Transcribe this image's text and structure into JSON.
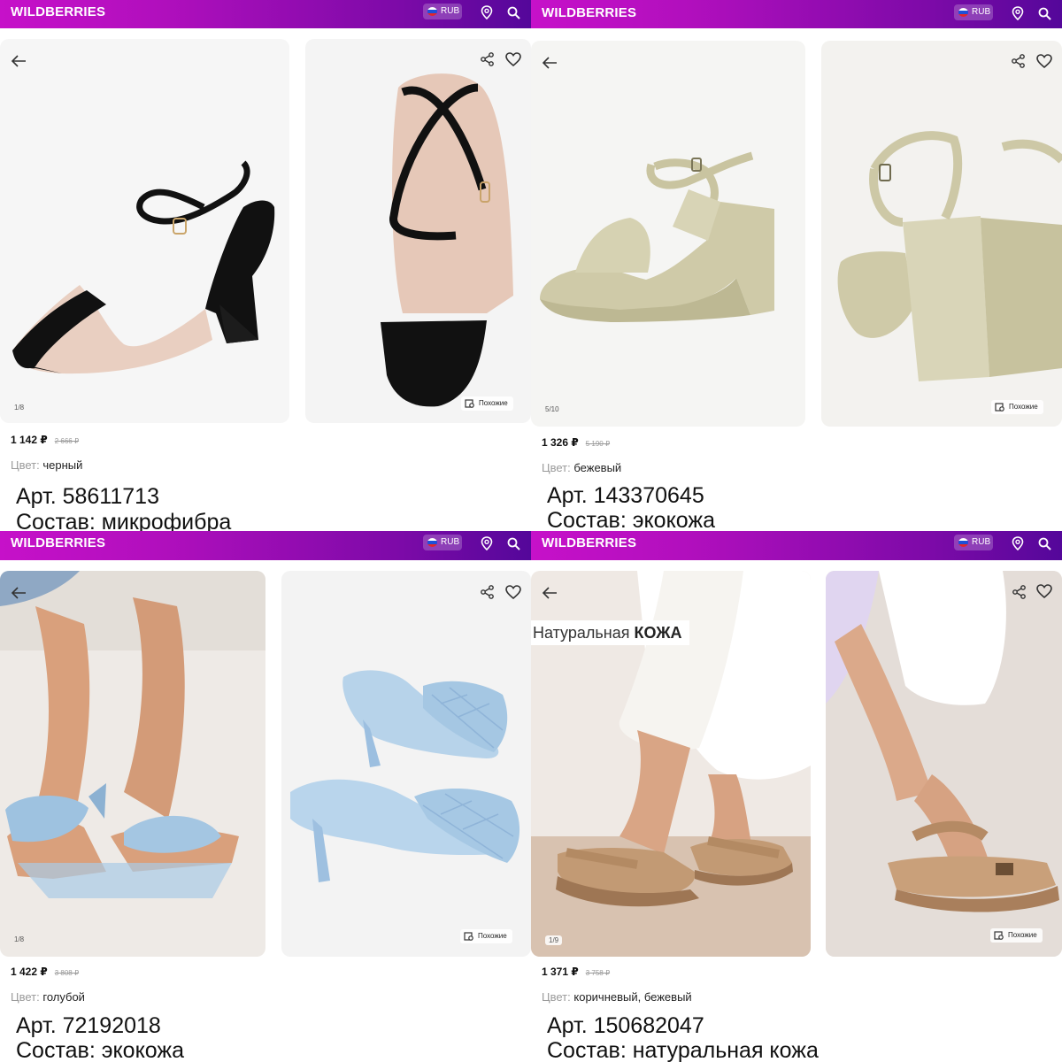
{
  "brand": "WILDBERRIES",
  "currency": "RUB",
  "similar_label": "Похожие",
  "color_label": "Цвет:",
  "products": [
    {
      "counter": "1/8",
      "price": "1 142 ₽",
      "old_price": "2 666 ₽",
      "color": "черный",
      "article": "Арт. 58611713",
      "composition": "Состав: микрофибра"
    },
    {
      "counter": "5/10",
      "price": "1 326 ₽",
      "old_price": "5 190 ₽",
      "color": "бежевый",
      "article": "Арт. 143370645",
      "composition": "Состав: экокожа"
    },
    {
      "counter": "1/8",
      "price": "1 422 ₽",
      "old_price": "3 808 ₽",
      "color": "голубой",
      "article": "Арт. 72192018",
      "composition": "Состав: экокожа"
    },
    {
      "counter": "1/9",
      "price": "1 371 ₽",
      "old_price": "3 758 ₽",
      "color": "коричневый, бежевый",
      "article": "Арт. 150682047",
      "composition": "Состав: натуральная кожа",
      "banner_prefix": "Натуральная",
      "banner_bold": "КОЖА"
    }
  ],
  "colors": {
    "header_start": "#c611c9",
    "header_end": "#54079a",
    "card_bg": "#f3f3f3"
  }
}
